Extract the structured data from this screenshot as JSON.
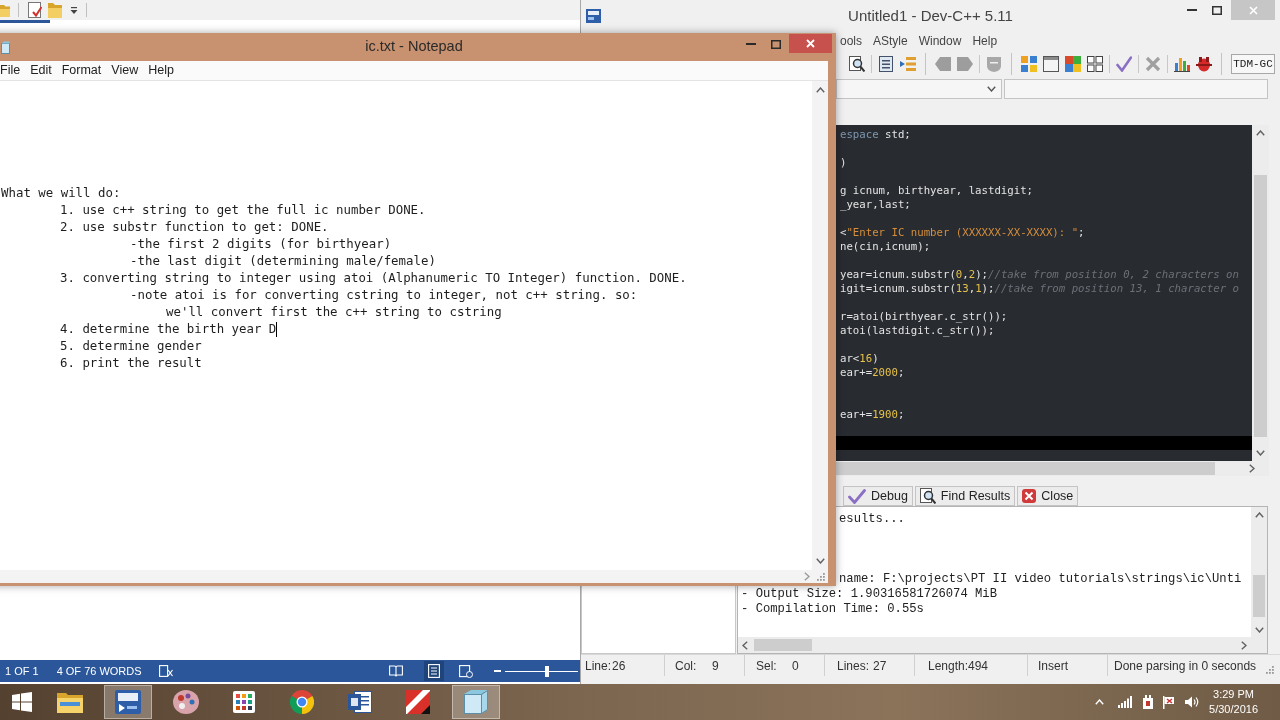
{
  "word_window": {
    "status_bar": {
      "page_count": "1 OF 1",
      "word_count": "4 OF 76 WORDS",
      "views": [
        {
          "kind": "read",
          "selected": false
        },
        {
          "kind": "print",
          "selected": true
        },
        {
          "kind": "web",
          "selected": false
        }
      ],
      "zoom": {
        "level": 0.58
      }
    }
  },
  "ide_window": {
    "title": "Untitled1 - Dev-C++ 5.11",
    "menu": [
      "ools",
      "AStyle",
      "Window",
      "Help"
    ],
    "compiler": "TDM-GC",
    "editor": {
      "lines": [
        {
          "kind": "code",
          "segments": [
            {
              "kind": "keyword",
              "text": "espace"
            },
            {
              "kind": "plain",
              "text": " std;"
            }
          ]
        },
        {
          "kind": "blank"
        },
        {
          "kind": "code",
          "segments": [
            {
              "kind": "plain",
              "text": ")"
            }
          ]
        },
        {
          "kind": "blank"
        },
        {
          "kind": "code",
          "segments": [
            {
              "kind": "plain",
              "text": "g icnum, birthyear, lastdigit;"
            }
          ]
        },
        {
          "kind": "code",
          "segments": [
            {
              "kind": "plain",
              "text": "_year,last;"
            }
          ]
        },
        {
          "kind": "blank"
        },
        {
          "kind": "code",
          "segments": [
            {
              "kind": "plain",
              "text": "<"
            },
            {
              "kind": "string",
              "text": "\"Enter IC number (XXXXXX-XX-XXXX): \""
            },
            {
              "kind": "plain",
              "text": ";"
            }
          ]
        },
        {
          "kind": "code",
          "segments": [
            {
              "kind": "plain",
              "text": "ne(cin,icnum);"
            }
          ]
        },
        {
          "kind": "blank"
        },
        {
          "kind": "code",
          "segments": [
            {
              "kind": "plain",
              "text": "year=icnum.substr("
            },
            {
              "kind": "number",
              "text": "0"
            },
            {
              "kind": "plain",
              "text": ","
            },
            {
              "kind": "number",
              "text": "2"
            },
            {
              "kind": "plain",
              "text": ");"
            },
            {
              "kind": "comment",
              "text": "//take from position 0, 2 characters on"
            }
          ]
        },
        {
          "kind": "code",
          "segments": [
            {
              "kind": "plain",
              "text": "igit=icnum.substr("
            },
            {
              "kind": "number",
              "text": "13"
            },
            {
              "kind": "plain",
              "text": ","
            },
            {
              "kind": "number",
              "text": "1"
            },
            {
              "kind": "plain",
              "text": ");"
            },
            {
              "kind": "comment",
              "text": "//take from position 13, 1 character o"
            }
          ]
        },
        {
          "kind": "blank"
        },
        {
          "kind": "code",
          "segments": [
            {
              "kind": "plain",
              "text": "r=atoi(birthyear.c_str());"
            }
          ]
        },
        {
          "kind": "code",
          "segments": [
            {
              "kind": "plain",
              "text": "atoi(lastdigit.c_str());"
            }
          ]
        },
        {
          "kind": "blank"
        },
        {
          "kind": "code",
          "segments": [
            {
              "kind": "plain",
              "text": "ar<"
            },
            {
              "kind": "number",
              "text": "16"
            },
            {
              "kind": "plain",
              "text": ")"
            }
          ]
        },
        {
          "kind": "code",
          "segments": [
            {
              "kind": "plain",
              "text": "ear+="
            },
            {
              "kind": "number",
              "text": "2000"
            },
            {
              "kind": "plain",
              "text": ";"
            }
          ]
        },
        {
          "kind": "blank"
        },
        {
          "kind": "blank"
        },
        {
          "kind": "code",
          "segments": [
            {
              "kind": "plain",
              "text": "ear+="
            },
            {
              "kind": "number",
              "text": "1900"
            },
            {
              "kind": "plain",
              "text": ";"
            }
          ]
        },
        {
          "kind": "blank"
        },
        {
          "kind": "blank",
          "current": true
        }
      ]
    },
    "bottom_tabs": [
      {
        "kind": "debug",
        "label": "Debug",
        "selected": false
      },
      {
        "kind": "find",
        "label": "Find Results",
        "selected": false
      },
      {
        "kind": "close",
        "label": "Close"
      }
    ],
    "output": {
      "lines": [
        {
          "kind": "cut",
          "text": "esults..."
        },
        {
          "kind": "blank"
        },
        {
          "kind": "blank"
        },
        {
          "kind": "blank"
        },
        {
          "kind": "cut",
          "text": "name: F:\\projects\\PT II video tutorials\\strings\\ic\\Unti"
        },
        {
          "kind": "full",
          "text": "- Output Size: 1.90316581726074 MiB"
        },
        {
          "kind": "full",
          "text": "- Compilation Time: 0.55s"
        }
      ]
    },
    "status_bar": {
      "fields": [
        {
          "label": "Line:",
          "value": "26"
        },
        {
          "label": "Col:",
          "value": "9"
        },
        {
          "label": "Sel:",
          "value": "0"
        },
        {
          "label": "Lines:",
          "value": "27"
        },
        {
          "label": "Length:",
          "value": "494"
        }
      ],
      "mode": "Insert",
      "message": "Done parsing in 0 seconds"
    }
  },
  "notepad_window": {
    "title": "ic.txt - Notepad",
    "menu": [
      "File",
      "Edit",
      "Format",
      "View",
      "Help"
    ],
    "lines": [
      {
        "text": "What we will do:",
        "children": [
          {
            "text": "1. use c++ string to get the full ic number DONE."
          },
          {
            "text": "2. use substr function to get: DONE.",
            "children": [
              {
                "text": "-the first 2 digits (for birthyear)"
              },
              {
                "text": "-the last digit (determining male/female)"
              }
            ]
          },
          {
            "text": "3. converting string to integer using atoi (Alphanumeric TO Integer) function. DONE.",
            "children": [
              {
                "text": "-note atoi is for converting cstring to integer, not c++ string. so:",
                "children": [
                  {
                    "text": "we'll convert first the c++ string to cstring"
                  }
                ]
              }
            ]
          },
          {
            "text": "4. determine the birth year D",
            "caret": true
          },
          {
            "text": "5. determine gender"
          },
          {
            "text": "6. print the result"
          }
        ]
      }
    ]
  },
  "taskbar": {
    "apps": [
      {
        "kind": "folder",
        "highlighted": false
      },
      {
        "kind": "ide",
        "highlighted": true
      },
      {
        "kind": "palette",
        "highlighted": false
      },
      {
        "kind": "grid",
        "highlighted": false
      },
      {
        "kind": "browser",
        "highlighted": false
      },
      {
        "kind": "writer",
        "highlighted": false
      },
      {
        "kind": "antivirus",
        "highlighted": false
      },
      {
        "kind": "notepad",
        "highlighted": true
      }
    ],
    "clock": {
      "time": "3:29 PM",
      "date": "5/30/2016"
    }
  }
}
